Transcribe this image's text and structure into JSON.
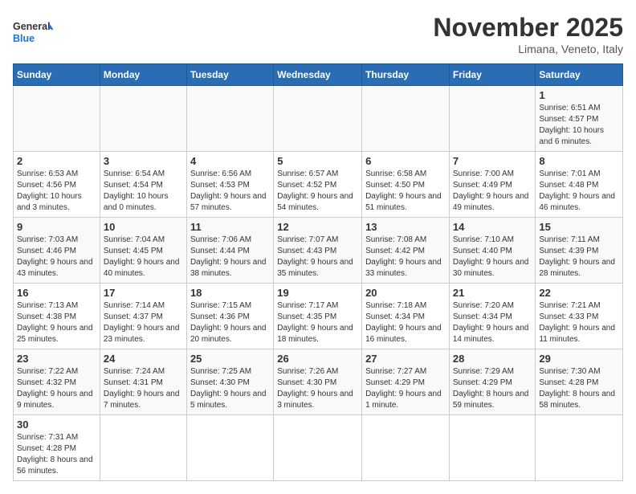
{
  "header": {
    "logo_general": "General",
    "logo_blue": "Blue",
    "month_title": "November 2025",
    "location": "Limana, Veneto, Italy"
  },
  "days_of_week": [
    "Sunday",
    "Monday",
    "Tuesday",
    "Wednesday",
    "Thursday",
    "Friday",
    "Saturday"
  ],
  "weeks": [
    [
      {
        "day": "",
        "info": ""
      },
      {
        "day": "",
        "info": ""
      },
      {
        "day": "",
        "info": ""
      },
      {
        "day": "",
        "info": ""
      },
      {
        "day": "",
        "info": ""
      },
      {
        "day": "",
        "info": ""
      },
      {
        "day": "1",
        "info": "Sunrise: 6:51 AM\nSunset: 4:57 PM\nDaylight: 10 hours and 6 minutes."
      }
    ],
    [
      {
        "day": "2",
        "info": "Sunrise: 6:53 AM\nSunset: 4:56 PM\nDaylight: 10 hours and 3 minutes."
      },
      {
        "day": "3",
        "info": "Sunrise: 6:54 AM\nSunset: 4:54 PM\nDaylight: 10 hours and 0 minutes."
      },
      {
        "day": "4",
        "info": "Sunrise: 6:56 AM\nSunset: 4:53 PM\nDaylight: 9 hours and 57 minutes."
      },
      {
        "day": "5",
        "info": "Sunrise: 6:57 AM\nSunset: 4:52 PM\nDaylight: 9 hours and 54 minutes."
      },
      {
        "day": "6",
        "info": "Sunrise: 6:58 AM\nSunset: 4:50 PM\nDaylight: 9 hours and 51 minutes."
      },
      {
        "day": "7",
        "info": "Sunrise: 7:00 AM\nSunset: 4:49 PM\nDaylight: 9 hours and 49 minutes."
      },
      {
        "day": "8",
        "info": "Sunrise: 7:01 AM\nSunset: 4:48 PM\nDaylight: 9 hours and 46 minutes."
      }
    ],
    [
      {
        "day": "9",
        "info": "Sunrise: 7:03 AM\nSunset: 4:46 PM\nDaylight: 9 hours and 43 minutes."
      },
      {
        "day": "10",
        "info": "Sunrise: 7:04 AM\nSunset: 4:45 PM\nDaylight: 9 hours and 40 minutes."
      },
      {
        "day": "11",
        "info": "Sunrise: 7:06 AM\nSunset: 4:44 PM\nDaylight: 9 hours and 38 minutes."
      },
      {
        "day": "12",
        "info": "Sunrise: 7:07 AM\nSunset: 4:43 PM\nDaylight: 9 hours and 35 minutes."
      },
      {
        "day": "13",
        "info": "Sunrise: 7:08 AM\nSunset: 4:42 PM\nDaylight: 9 hours and 33 minutes."
      },
      {
        "day": "14",
        "info": "Sunrise: 7:10 AM\nSunset: 4:40 PM\nDaylight: 9 hours and 30 minutes."
      },
      {
        "day": "15",
        "info": "Sunrise: 7:11 AM\nSunset: 4:39 PM\nDaylight: 9 hours and 28 minutes."
      }
    ],
    [
      {
        "day": "16",
        "info": "Sunrise: 7:13 AM\nSunset: 4:38 PM\nDaylight: 9 hours and 25 minutes."
      },
      {
        "day": "17",
        "info": "Sunrise: 7:14 AM\nSunset: 4:37 PM\nDaylight: 9 hours and 23 minutes."
      },
      {
        "day": "18",
        "info": "Sunrise: 7:15 AM\nSunset: 4:36 PM\nDaylight: 9 hours and 20 minutes."
      },
      {
        "day": "19",
        "info": "Sunrise: 7:17 AM\nSunset: 4:35 PM\nDaylight: 9 hours and 18 minutes."
      },
      {
        "day": "20",
        "info": "Sunrise: 7:18 AM\nSunset: 4:34 PM\nDaylight: 9 hours and 16 minutes."
      },
      {
        "day": "21",
        "info": "Sunrise: 7:20 AM\nSunset: 4:34 PM\nDaylight: 9 hours and 14 minutes."
      },
      {
        "day": "22",
        "info": "Sunrise: 7:21 AM\nSunset: 4:33 PM\nDaylight: 9 hours and 11 minutes."
      }
    ],
    [
      {
        "day": "23",
        "info": "Sunrise: 7:22 AM\nSunset: 4:32 PM\nDaylight: 9 hours and 9 minutes."
      },
      {
        "day": "24",
        "info": "Sunrise: 7:24 AM\nSunset: 4:31 PM\nDaylight: 9 hours and 7 minutes."
      },
      {
        "day": "25",
        "info": "Sunrise: 7:25 AM\nSunset: 4:30 PM\nDaylight: 9 hours and 5 minutes."
      },
      {
        "day": "26",
        "info": "Sunrise: 7:26 AM\nSunset: 4:30 PM\nDaylight: 9 hours and 3 minutes."
      },
      {
        "day": "27",
        "info": "Sunrise: 7:27 AM\nSunset: 4:29 PM\nDaylight: 9 hours and 1 minute."
      },
      {
        "day": "28",
        "info": "Sunrise: 7:29 AM\nSunset: 4:29 PM\nDaylight: 8 hours and 59 minutes."
      },
      {
        "day": "29",
        "info": "Sunrise: 7:30 AM\nSunset: 4:28 PM\nDaylight: 8 hours and 58 minutes."
      }
    ],
    [
      {
        "day": "30",
        "info": "Sunrise: 7:31 AM\nSunset: 4:28 PM\nDaylight: 8 hours and 56 minutes."
      },
      {
        "day": "",
        "info": ""
      },
      {
        "day": "",
        "info": ""
      },
      {
        "day": "",
        "info": ""
      },
      {
        "day": "",
        "info": ""
      },
      {
        "day": "",
        "info": ""
      },
      {
        "day": "",
        "info": ""
      }
    ]
  ]
}
